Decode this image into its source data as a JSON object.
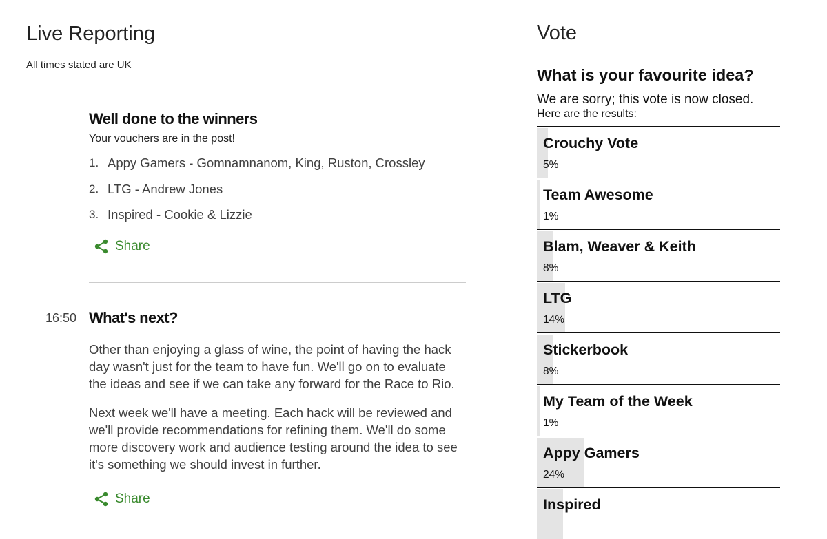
{
  "live": {
    "title": "Live Reporting",
    "subtitle": "All times stated are UK"
  },
  "posts": [
    {
      "title": "Well done to the winners",
      "intro": "Your vouchers are in the post!",
      "winners": [
        {
          "num": "1.",
          "text": "Appy Gamers - Gomnamnanom, King, Ruston, Crossley"
        },
        {
          "num": "2.",
          "text": "LTG - Andrew Jones"
        },
        {
          "num": "3.",
          "text": "Inspired - Cookie & Lizzie"
        }
      ],
      "share_label": "Share"
    },
    {
      "time": "16:50",
      "title": "What's next?",
      "paragraphs": [
        "Other than enjoying a glass of wine, the point of having the hack day wasn't just for the team to have fun. We'll go on to evaluate the ideas and see if we can take any forward for the Race to Rio.",
        "Next week we'll have a meeting. Each hack will be reviewed and we'll provide recommendations for refining them.  We'll do some more discovery work and audience testing around the idea to see it's something we should invest in further."
      ],
      "share_label": "Share"
    }
  ],
  "vote": {
    "heading": "Vote",
    "question": "What is your favourite idea?",
    "closed_message": "We are sorry; this vote is now closed.",
    "results_label": "Here are the results:",
    "results": [
      {
        "name": "Crouchy Vote",
        "percent": "5%",
        "share": 0.05
      },
      {
        "name": "Team Awesome",
        "percent": "1%",
        "share": 0.01
      },
      {
        "name": "Blam, Weaver & Keith",
        "percent": "8%",
        "share": 0.08
      },
      {
        "name": "LTG",
        "percent": "14%",
        "share": 0.14
      },
      {
        "name": "Stickerbook",
        "percent": "8%",
        "share": 0.08
      },
      {
        "name": "My Team of the Week",
        "percent": "1%",
        "share": 0.01
      },
      {
        "name": "Appy Gamers",
        "percent": "24%",
        "share": 0.24
      },
      {
        "name": "Inspired",
        "percent": "",
        "share": 0.13
      }
    ]
  },
  "colors": {
    "share_green": "#3a8a2e",
    "result_bar": "#e4e4e4"
  },
  "icons": {
    "share": "share-icon"
  }
}
